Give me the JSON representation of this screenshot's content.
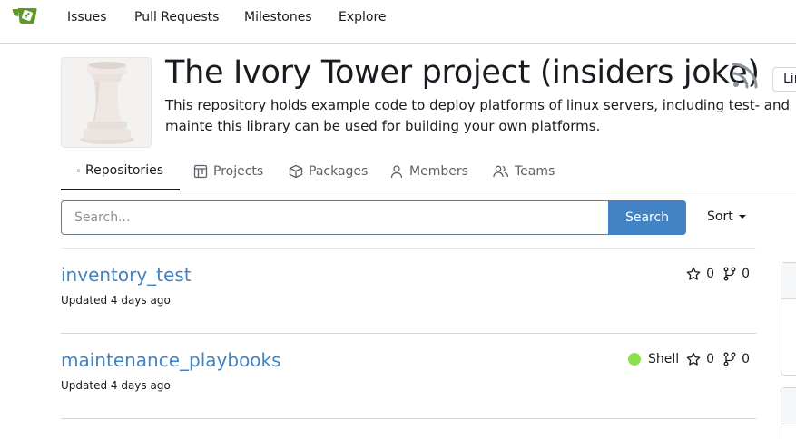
{
  "nav": {
    "logo_icon": "gitea-logo-icon",
    "links": [
      "Issues",
      "Pull Requests",
      "Milestones",
      "Explore"
    ]
  },
  "org": {
    "title": "The Ivory Tower project (insiders joke)",
    "description": "This repository holds example code to deploy platforms of linux servers, including test- and mainte this library can be used for building your own platforms.",
    "lang_button": "Lin",
    "rss_icon": "rss-icon",
    "avatar_icon": "rook-chess-piece-avatar"
  },
  "tabs": [
    {
      "label": "Repositories",
      "icon": "repo-icon",
      "active": true
    },
    {
      "label": "Projects",
      "icon": "project-icon",
      "active": false
    },
    {
      "label": "Packages",
      "icon": "package-icon",
      "active": false
    },
    {
      "label": "Members",
      "icon": "person-icon",
      "active": false
    },
    {
      "label": "Teams",
      "icon": "people-icon",
      "active": false
    }
  ],
  "search": {
    "placeholder": "Search...",
    "value": "",
    "button_label": "Search",
    "sort_label": "Sort"
  },
  "repos": [
    {
      "name": "inventory_test",
      "updated": "Updated 4 days ago",
      "language": "",
      "stars": "0",
      "forks": "0"
    },
    {
      "name": "maintenance_playbooks",
      "updated": "Updated 4 days ago",
      "language": "Shell",
      "language_color": "#89e051",
      "stars": "0",
      "forks": "0"
    }
  ],
  "colors": {
    "accent": "#4183c4",
    "text": "#181c21",
    "shell": "#89e051"
  }
}
